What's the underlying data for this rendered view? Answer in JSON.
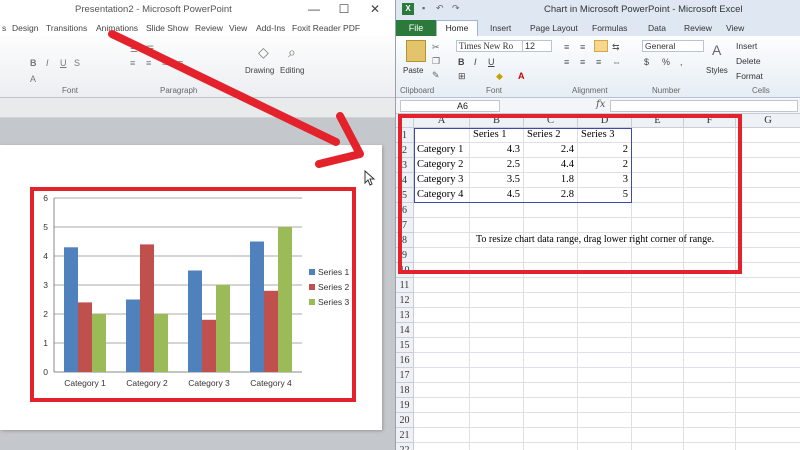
{
  "powerpoint": {
    "window_title": "Presentation2 - Microsoft PowerPoint",
    "tabs": [
      "Design",
      "Transitions",
      "Animations",
      "Slide Show",
      "Review",
      "View",
      "Add-Ins",
      "Foxit Reader PDF"
    ],
    "ribbon_groups": [
      "Font",
      "Paragraph",
      "Drawing",
      "Editing"
    ]
  },
  "excel": {
    "window_title": "Chart in Microsoft PowerPoint - Microsoft Excel",
    "file_tab": "File",
    "tabs": [
      "Home",
      "Insert",
      "Page Layout",
      "Formulas",
      "Data",
      "Review",
      "View"
    ],
    "font_name": "Times New Ro",
    "font_size": "12",
    "number_format": "General",
    "ribbon_groups": [
      "Clipboard",
      "Font",
      "Alignment",
      "Number",
      "Cells"
    ],
    "ribbon_buttons": {
      "paste": "Paste",
      "styles": "Styles",
      "insert": "Insert",
      "delete": "Delete",
      "format": "Format"
    },
    "name_box": "A6",
    "fx": "fx",
    "columns": [
      "A",
      "B",
      "C",
      "D",
      "E",
      "F",
      "G"
    ],
    "rows": [
      "1",
      "2",
      "3",
      "4",
      "5",
      "6",
      "7",
      "8",
      "9",
      "10",
      "11",
      "12",
      "13",
      "14",
      "15",
      "16",
      "17",
      "18",
      "19",
      "20",
      "21",
      "22"
    ],
    "header_row": [
      "",
      "Series 1",
      "Series 2",
      "Series 3"
    ],
    "data_rows": [
      [
        "Category 1",
        "4.3",
        "2.4",
        "2"
      ],
      [
        "Category 2",
        "2.5",
        "4.4",
        "2"
      ],
      [
        "Category 3",
        "3.5",
        "1.8",
        "3"
      ],
      [
        "Category 4",
        "4.5",
        "2.8",
        "5"
      ]
    ],
    "note": "To resize chart data range, drag lower right corner of range."
  },
  "chart_data": {
    "type": "bar",
    "categories": [
      "Category 1",
      "Category 2",
      "Category 3",
      "Category 4"
    ],
    "series": [
      {
        "name": "Series 1",
        "values": [
          4.3,
          2.5,
          3.5,
          4.5
        ],
        "color": "#4f81bd"
      },
      {
        "name": "Series 2",
        "values": [
          2.4,
          4.4,
          1.8,
          2.8
        ],
        "color": "#c0504d"
      },
      {
        "name": "Series 3",
        "values": [
          2,
          2,
          3,
          5
        ],
        "color": "#9bbb59"
      }
    ],
    "ylim": [
      0,
      6
    ],
    "yticks": [
      "0",
      "1",
      "2",
      "3",
      "4",
      "5",
      "6"
    ],
    "grid": true,
    "legend": "right"
  },
  "colors": {
    "highlight": "#e4222b",
    "excel_file_tab": "#2b7a3c"
  }
}
